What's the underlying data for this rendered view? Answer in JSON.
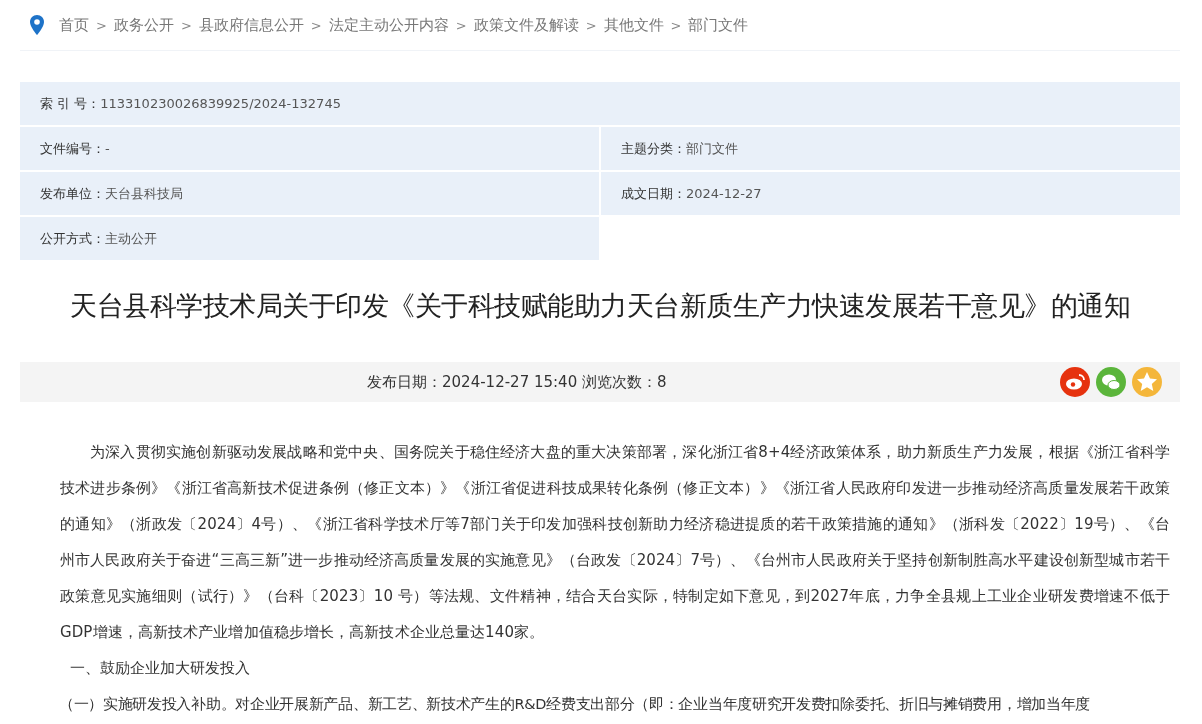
{
  "breadcrumb": [
    "首页",
    "政务公开",
    "县政府信息公开",
    "法定主动公开内容",
    "政策文件及解读",
    "其他文件",
    "部门文件"
  ],
  "breadcrumb_separator": ">",
  "meta": [
    {
      "label": "索 引 号：",
      "value": "113310230026839925/2024-132745",
      "kind": "wide"
    },
    {
      "label": "文件编号：",
      "value": "-",
      "kind": "half"
    },
    {
      "label": "主题分类：",
      "value": "部门文件",
      "kind": "half"
    },
    {
      "label": "发布单位：",
      "value": "天台县科技局",
      "kind": "half"
    },
    {
      "label": "成文日期：",
      "value": "2024-12-27",
      "kind": "half"
    },
    {
      "label": "公开方式：",
      "value": "主动公开",
      "kind": "half"
    }
  ],
  "title": "天台县科学技术局关于印发《关于科技赋能助力天台新质生产力快速发展若干意见》的通知",
  "info": "发布日期：2024-12-27 15:40 浏览次数：8",
  "share": [
    {
      "kind": "weibo",
      "color": "#e6320e"
    },
    {
      "kind": "wechat",
      "color": "#5bb53b"
    },
    {
      "kind": "qzone",
      "color": "#f4b63a"
    }
  ],
  "paragraphs": [
    {
      "kind": "body",
      "text": "为深入贯彻实施创新驱动发展战略和党中央、国务院关于稳住经济大盘的重大决策部署，深化浙江省8+4经济政策体系，助力新质生产力发展，根据《浙江省科学技术进步条例》《浙江省高新技术促进条例（修正文本）》《浙江省促进科技成果转化条例（修正文本）》《浙江省人民政府印发进一步推动经济高质量发展若干政策的通知》（浙政发〔2024〕4号）、《浙江省科学技术厅等7部门关于印发加强科技创新助力经济稳进提质的若干政策措施的通知》（浙科发〔2022〕19号）、《台州市人民政府关于奋进“三高三新”进一步推动经济高质量发展的实施意见》（台政发〔2024〕7号）、《台州市人民政府关于坚持创新制胜高水平建设创新型城市若干政策意见实施细则（试行）》（台科〔2023〕10 号）等法规、文件精神，结合天台实际，特制定如下意见，到2027年底，力争全县规上工业企业研发费增速不低于GDP增速，高新技术产业增加值稳步增长，高新技术企业总量达140家。"
    },
    {
      "kind": "heading",
      "text": "一、鼓励企业加大研发投入"
    },
    {
      "kind": "clause",
      "text": "（一）实施研发投入补助。对企业开展新产品、新工艺、新技术产生的R&D经费支出部分（即：企业当年度研究开发费扣除委托、折旧与摊销费用，增加当年度"
    }
  ]
}
